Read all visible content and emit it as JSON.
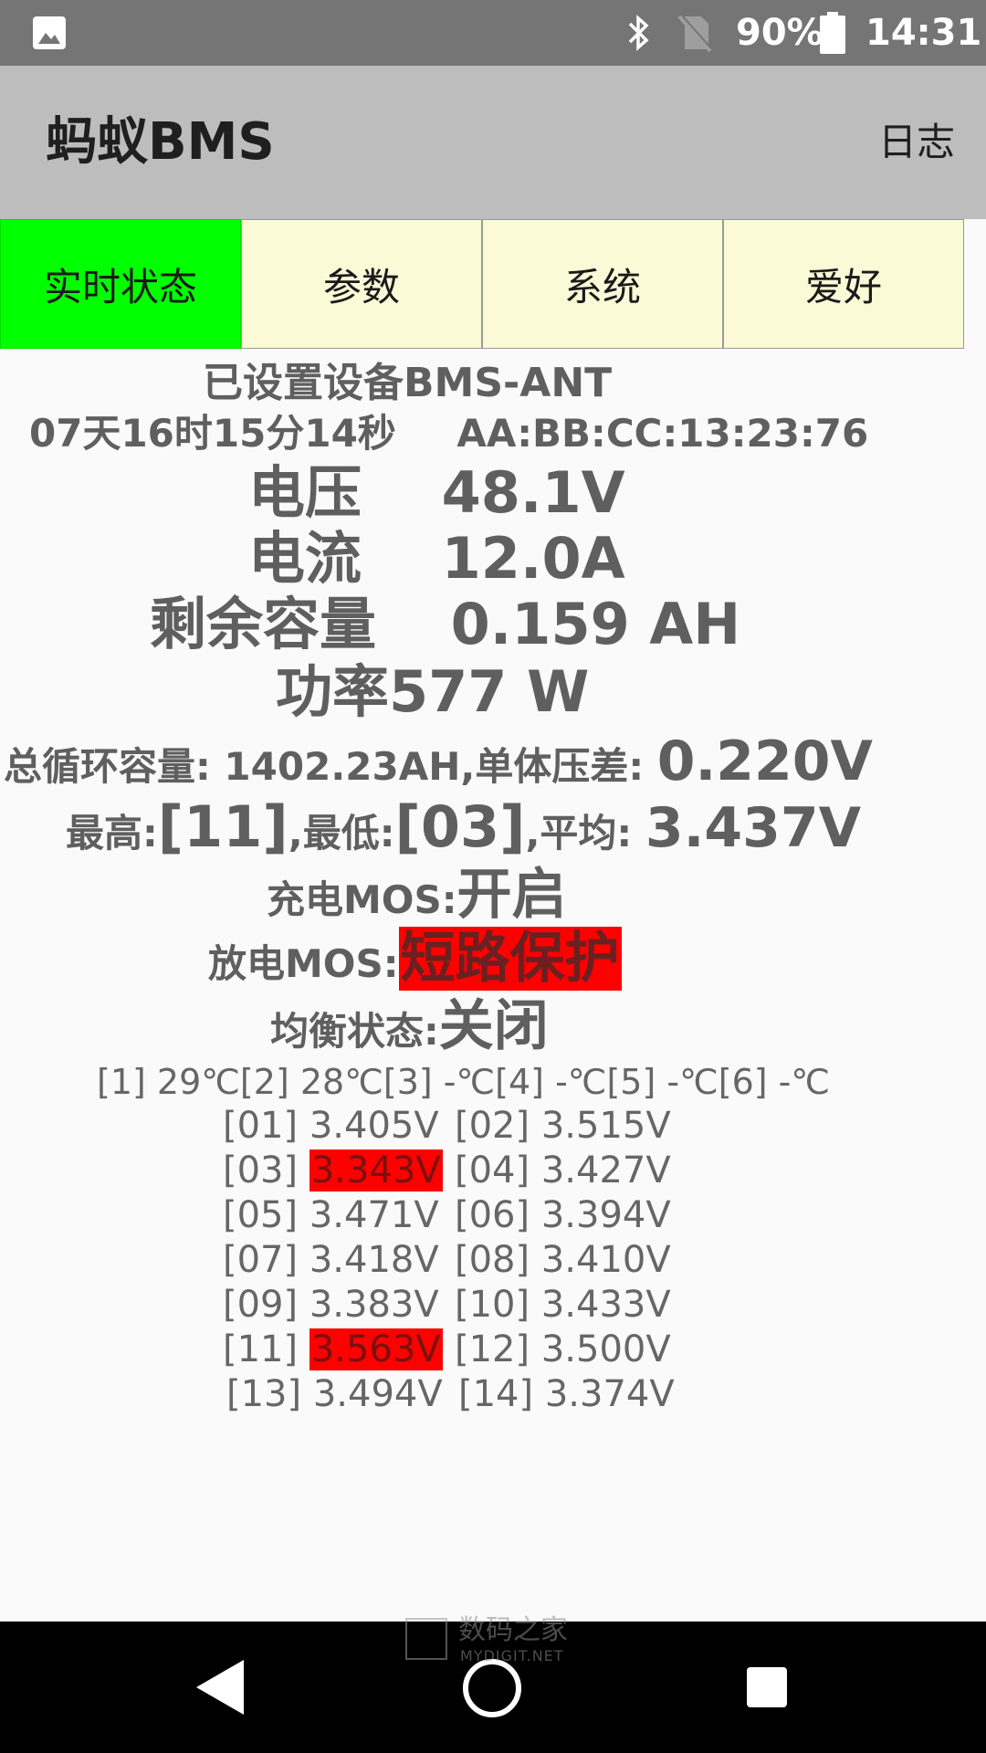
{
  "status_bar": {
    "battery_percent": "90%",
    "time": "14:31"
  },
  "app_bar": {
    "title": "蚂蚁BMS",
    "log_label": "日志"
  },
  "tabs": [
    {
      "label": "实时状态",
      "active": true
    },
    {
      "label": "参数",
      "active": false
    },
    {
      "label": "系统",
      "active": false
    },
    {
      "label": "爱好",
      "active": false
    }
  ],
  "status": {
    "device": "已设置设备BMS-ANT",
    "uptime": "07天16时15分14秒",
    "mac": "AA:BB:CC:13:23:76",
    "voltage_label": "电压",
    "voltage_value": "48.1V",
    "current_label": "电流",
    "current_value": "12.0A",
    "capacity_label": "剩余容量",
    "capacity_value": "0.159 AH",
    "power_label": "功率",
    "power_value": "577 W",
    "cycle_label": "总循环容量: ",
    "cycle_value": "1402.23AH,",
    "diff_label": "单体压差: ",
    "diff_value": "0.220V",
    "max_label": "最高:",
    "max_value": "[11]",
    "min_label": ",最低:",
    "min_value": "[03]",
    "avg_label": ",平均: ",
    "avg_value": "3.437V",
    "charge_mos_label": "充电MOS:",
    "charge_mos_value": "开启",
    "discharge_mos_label": "放电MOS:",
    "discharge_mos_value": "短路保护",
    "balance_label": "均衡状态:",
    "balance_value": "关闭",
    "temperatures": "[1] 29℃[2] 28℃[3] -℃[4] -℃[5] -℃[6] -℃"
  },
  "cells": [
    {
      "id": "[01]",
      "voltage": "3.405V",
      "highlight": false
    },
    {
      "id": "[02]",
      "voltage": "3.515V",
      "highlight": false
    },
    {
      "id": "[03]",
      "voltage": "3.343V",
      "highlight": true
    },
    {
      "id": "[04]",
      "voltage": "3.427V",
      "highlight": false
    },
    {
      "id": "[05]",
      "voltage": "3.471V",
      "highlight": false
    },
    {
      "id": "[06]",
      "voltage": "3.394V",
      "highlight": false
    },
    {
      "id": "[07]",
      "voltage": "3.418V",
      "highlight": false
    },
    {
      "id": "[08]",
      "voltage": "3.410V",
      "highlight": false
    },
    {
      "id": "[09]",
      "voltage": "3.383V",
      "highlight": false
    },
    {
      "id": "[10]",
      "voltage": "3.433V",
      "highlight": false
    },
    {
      "id": "[11]",
      "voltage": "3.563V",
      "highlight": true
    },
    {
      "id": "[12]",
      "voltage": "3.500V",
      "highlight": false
    },
    {
      "id": "[13]",
      "voltage": "3.494V",
      "highlight": false
    },
    {
      "id": "[14]",
      "voltage": "3.374V",
      "highlight": false
    }
  ],
  "watermark": {
    "text": "数码之家",
    "sub": "MYDIGIT.NET"
  },
  "colors": {
    "active_tab": "#00ff00",
    "tab_bg": "#fafad7",
    "alert": "#ff0000",
    "app_bar": "#bdbdbd",
    "status_bar": "#757575"
  }
}
